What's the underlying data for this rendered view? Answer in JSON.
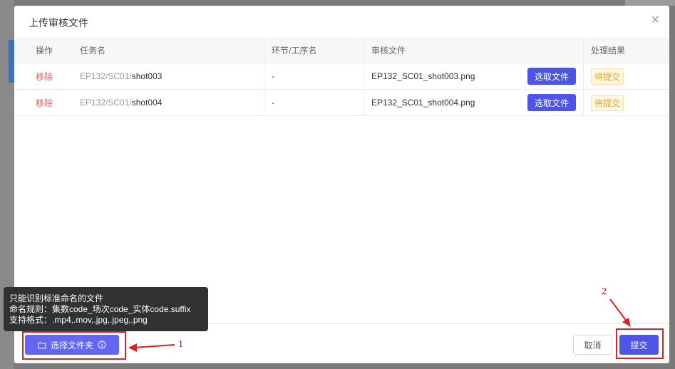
{
  "dialog": {
    "title": "上传审核文件",
    "close_icon": "×"
  },
  "table": {
    "columns": [
      "操作",
      "任务名",
      "环节/工序名",
      "审核文件",
      "处理结果"
    ],
    "rows": [
      {
        "action": "移除",
        "task_prefix": "EP132/SC01/",
        "task_name": "shot003",
        "step": "-",
        "file": "EP132_SC01_shot003.png",
        "pick_button": "选取文件",
        "status": "待提交"
      },
      {
        "action": "移除",
        "task_prefix": "EP132/SC01/",
        "task_name": "shot004",
        "step": "-",
        "file": "EP132_SC01_shot004.png",
        "pick_button": "选取文件",
        "status": "待提交"
      }
    ]
  },
  "tooltip": {
    "line1": "只能识别标准命名的文件",
    "line2": "命名规则：集数code_场次code_实体code.suffix",
    "line3": "支持格式：.mp4,.mov,.jpg,.jpeg,.png"
  },
  "footer": {
    "select_folder_label": "选择文件夹",
    "cancel_label": "取消",
    "submit_label": "提交"
  },
  "annotations": {
    "marker1": "1",
    "marker2": "2"
  },
  "colors": {
    "primary": "#4d55e8",
    "danger": "#e95a5a",
    "warning": "#e6a23c",
    "annotation_red": "#e02020"
  }
}
